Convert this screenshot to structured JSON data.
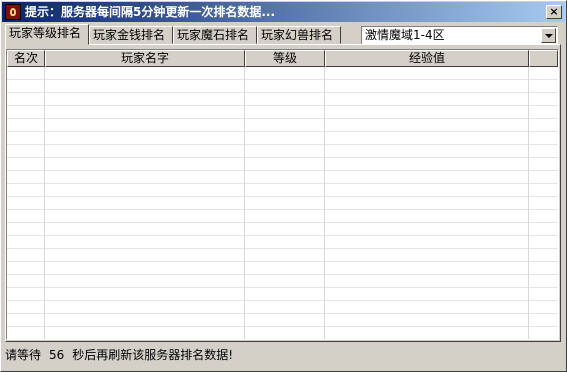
{
  "title": "提示：服务器每间隔5分钟更新一次排名数据...",
  "close_label": "×",
  "tabs": [
    {
      "label": "玩家等级排名",
      "active": true
    },
    {
      "label": "玩家金钱排名",
      "active": false
    },
    {
      "label": "玩家魔石排名",
      "active": false
    },
    {
      "label": "玩家幻兽排名",
      "active": false
    }
  ],
  "server_select": {
    "value": "激情魔域1-4区"
  },
  "columns": [
    "名次",
    "玩家名字",
    "等级",
    "经验值"
  ],
  "rows": [],
  "status": {
    "prefix": "请等待",
    "seconds": "56",
    "suffix": "秒后再刷新该服务器排名数据!"
  },
  "colors": {
    "titlebar_start": "#0a246a",
    "titlebar_end": "#a6caf0",
    "face": "#d4d0c8"
  }
}
